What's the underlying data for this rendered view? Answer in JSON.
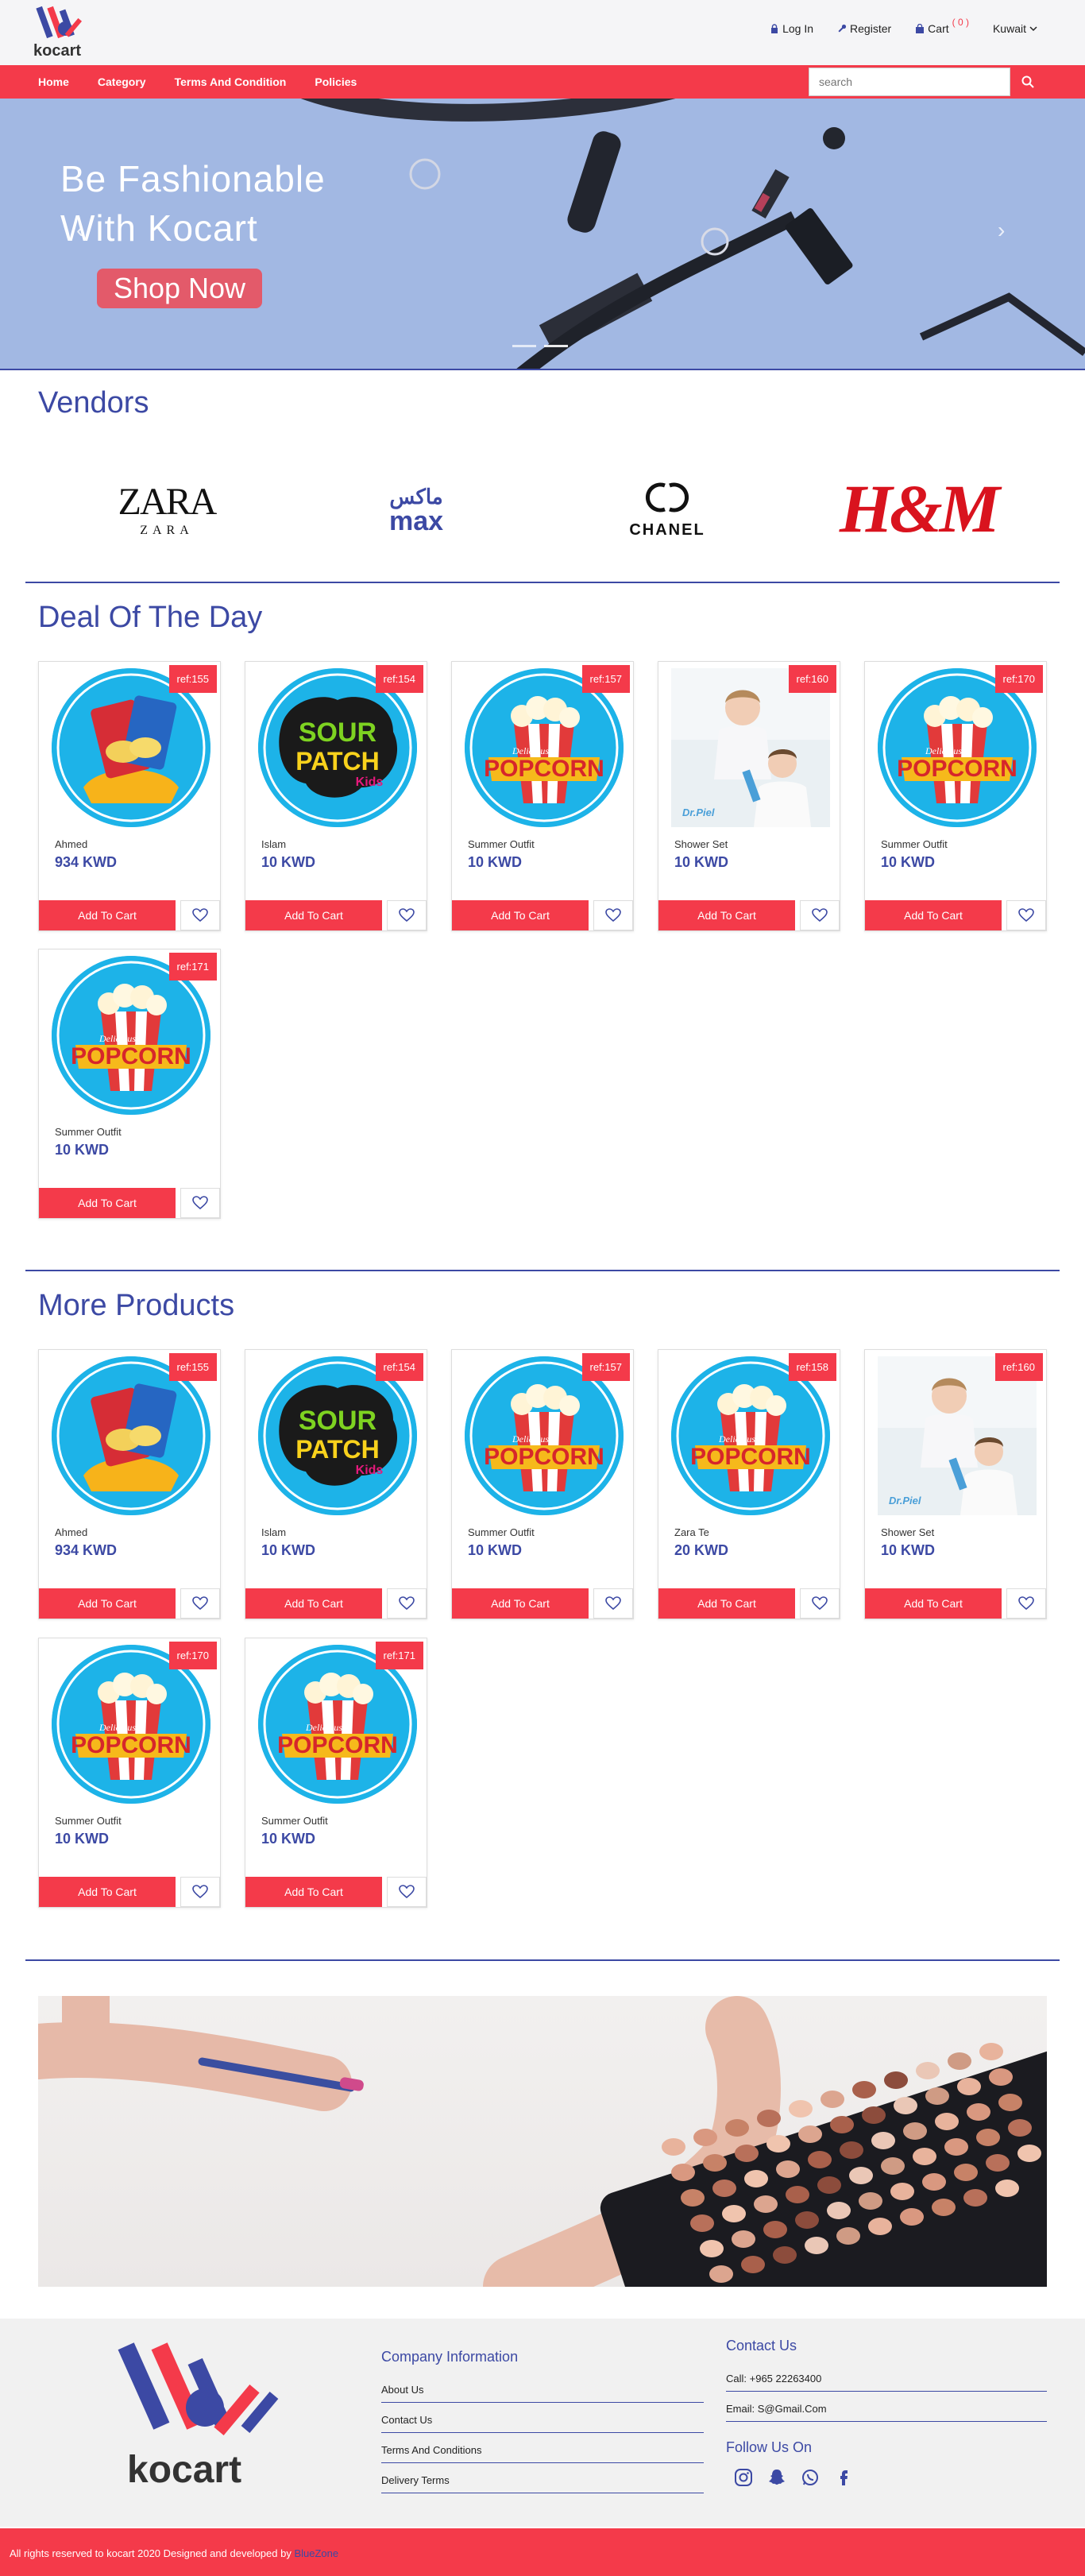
{
  "brand": {
    "name": "kocart"
  },
  "top_links": {
    "login": "Log In",
    "register": "Register",
    "cart": "Cart",
    "cart_count": "( 0 )",
    "country": "Kuwait"
  },
  "nav": {
    "items": [
      "Home",
      "Category",
      "Terms And Condition",
      "Policies"
    ],
    "search_placeholder": "search"
  },
  "hero": {
    "line1": "Be Fashionable",
    "line2": "With Kocart",
    "cta": "Shop Now"
  },
  "vendors": {
    "title": "Vendors",
    "items": [
      "ZARA",
      "max",
      "CHANEL",
      "H&M"
    ]
  },
  "deal_of_day": {
    "title": "Deal Of The Day",
    "products": [
      {
        "ref": "ref:155",
        "name": "Ahmed",
        "price": "934 KWD",
        "image": "chips"
      },
      {
        "ref": "ref:154",
        "name": "Islam",
        "price": "10 KWD",
        "image": "sour-patch"
      },
      {
        "ref": "ref:157",
        "name": "Summer Outfit",
        "price": "10 KWD",
        "image": "popcorn"
      },
      {
        "ref": "ref:160",
        "name": "Shower Set",
        "price": "10 KWD",
        "image": "kids"
      },
      {
        "ref": "ref:170",
        "name": "Summer Outfit",
        "price": "10 KWD",
        "image": "popcorn"
      },
      {
        "ref": "ref:171",
        "name": "Summer Outfit",
        "price": "10 KWD",
        "image": "popcorn"
      }
    ]
  },
  "more_products": {
    "title": "More Products",
    "products": [
      {
        "ref": "ref:155",
        "name": "Ahmed",
        "price": "934 KWD",
        "image": "chips"
      },
      {
        "ref": "ref:154",
        "name": "Islam",
        "price": "10 KWD",
        "image": "sour-patch"
      },
      {
        "ref": "ref:157",
        "name": "Summer Outfit",
        "price": "10 KWD",
        "image": "popcorn"
      },
      {
        "ref": "ref:158",
        "name": "Zara Te",
        "price": "20 KWD",
        "image": "popcorn"
      },
      {
        "ref": "ref:160",
        "name": "Shower Set",
        "price": "10 KWD",
        "image": "kids"
      },
      {
        "ref": "ref:170",
        "name": "Summer Outfit",
        "price": "10 KWD",
        "image": "popcorn"
      },
      {
        "ref": "ref:171",
        "name": "Summer Outfit",
        "price": "10 KWD",
        "image": "popcorn"
      }
    ]
  },
  "card_labels": {
    "add_to_cart": "Add To Cart"
  },
  "footer": {
    "company_title": "Company Information",
    "company_links": [
      "About Us",
      "Contact Us",
      "Terms And Conditions",
      "Delivery Terms"
    ],
    "contact_title": "Contact Us",
    "call": "Call: +965 22263400",
    "email": "Email: S@Gmail.Com",
    "follow_title": "Follow Us On",
    "social": [
      "instagram-icon",
      "snapchat-icon",
      "whatsapp-icon",
      "facebook-icon"
    ],
    "copyright": "All rights reserved to kocart 2020 Designed and developed by ",
    "developer": "BlueZone"
  },
  "colors": {
    "accent": "#f43a4a",
    "primary": "#3c49a4",
    "hero_bg": "#a2b8e3"
  }
}
